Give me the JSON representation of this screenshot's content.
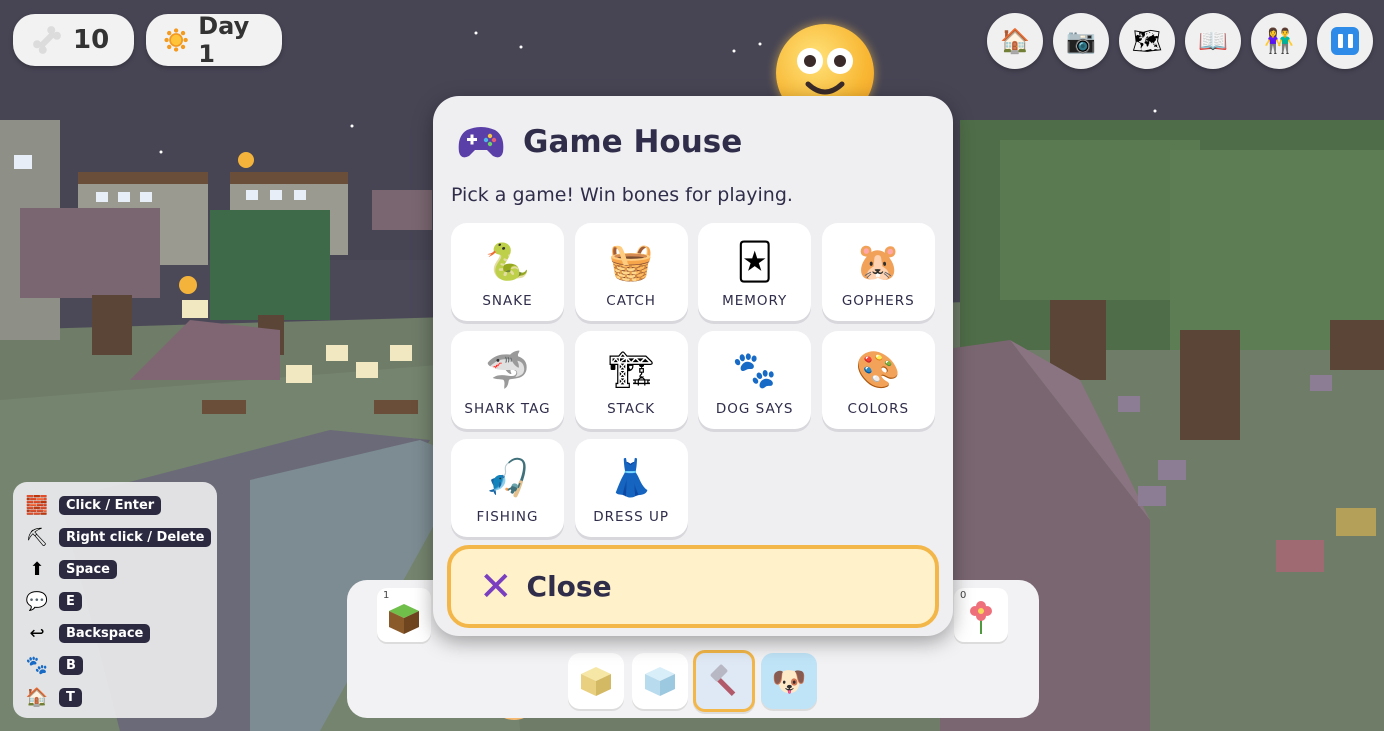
{
  "hud": {
    "bones": "10",
    "bones_icon": "bone-icon",
    "day": "Day 1",
    "day_icon": "sun-icon",
    "buttons": [
      {
        "name": "home-button",
        "icon": "🏠"
      },
      {
        "name": "camera-button",
        "icon": "📷"
      },
      {
        "name": "map-button",
        "icon": "🗺"
      },
      {
        "name": "book-button",
        "icon": "📖"
      },
      {
        "name": "friends-button",
        "icon": "👫"
      },
      {
        "name": "pause-button",
        "icon": "pause-icon"
      }
    ]
  },
  "modal": {
    "title": "Game House",
    "title_icon": "gamepad-icon",
    "subtitle": "Pick a game! Win bones for playing.",
    "games": [
      {
        "label": "SNAKE",
        "icon": "🐍"
      },
      {
        "label": "CATCH",
        "icon": "🧺"
      },
      {
        "label": "MEMORY",
        "icon": "🃏"
      },
      {
        "label": "GOPHERS",
        "icon": "🐹"
      },
      {
        "label": "SHARK TAG",
        "icon": "🦈"
      },
      {
        "label": "STACK",
        "icon": "🏗"
      },
      {
        "label": "DOG SAYS",
        "icon": "🐾"
      },
      {
        "label": "COLORS",
        "icon": "🎨"
      },
      {
        "label": "FISHING",
        "icon": "🎣"
      },
      {
        "label": "DRESS UP",
        "icon": "👗"
      }
    ],
    "close_label": "Close"
  },
  "hotbar": {
    "slots": [
      {
        "count": "1",
        "icon": "grass-block-icon"
      },
      {
        "count": "0",
        "icon": "flower-icon"
      }
    ],
    "tools": [
      {
        "name": "sand-block-tool",
        "icon": "sand-block-icon"
      },
      {
        "name": "ice-block-tool",
        "icon": "ice-block-icon"
      },
      {
        "name": "hammer-tool",
        "icon": "hammer-icon",
        "active": true
      },
      {
        "name": "dog-tool",
        "icon": "dog-icon"
      }
    ]
  },
  "controls": [
    {
      "icon": "🧱",
      "key": "Click / Enter"
    },
    {
      "icon": "⛏",
      "key": "Right click / Delete"
    },
    {
      "icon": "⬆",
      "key": "Space"
    },
    {
      "icon": "💬",
      "key": "E"
    },
    {
      "icon": "↩",
      "key": "Backspace"
    },
    {
      "icon": "🐾",
      "key": "B"
    },
    {
      "icon": "🏠",
      "key": "T"
    }
  ],
  "colors": {
    "accent": "#f3b648",
    "dark_text": "#2f2d4a",
    "close_bg": "#fff1c9",
    "pause_blue": "#2f8be8"
  }
}
